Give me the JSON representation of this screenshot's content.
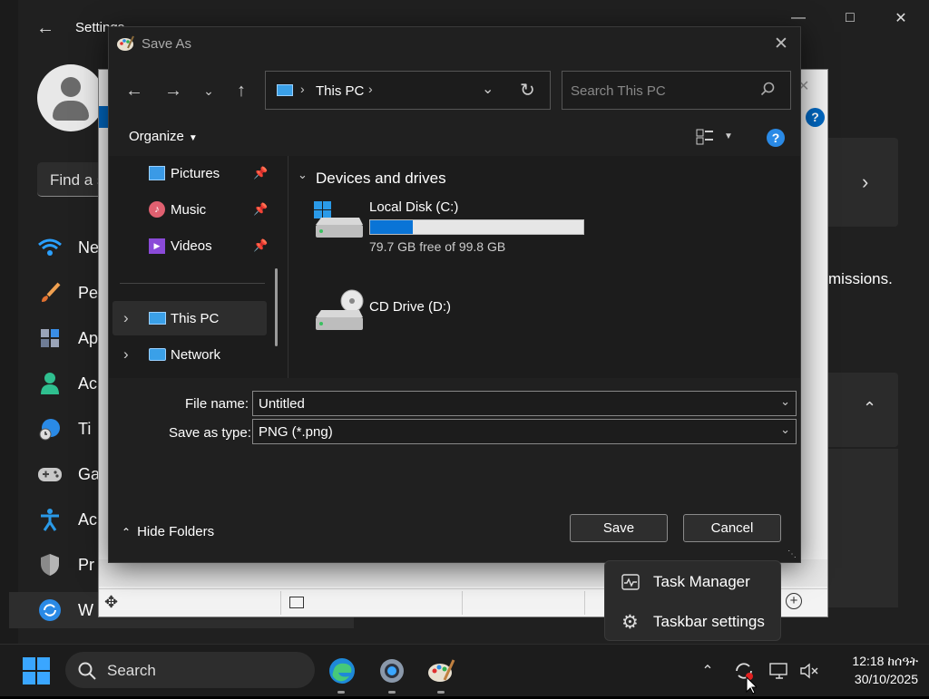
{
  "settings": {
    "title": "Settings",
    "search_placeholder": "Find a s",
    "nav": [
      {
        "label": "Ne",
        "icon": "wifi-icon"
      },
      {
        "label": "Pe",
        "icon": "brush-icon"
      },
      {
        "label": "Ap",
        "icon": "apps-icon"
      },
      {
        "label": "Ac",
        "icon": "person-icon"
      },
      {
        "label": "Ti",
        "icon": "clock-globe-icon"
      },
      {
        "label": "Ga",
        "icon": "gamepad-icon"
      },
      {
        "label": "Ac",
        "icon": "accessibility-icon"
      },
      {
        "label": "Pr",
        "icon": "shield-icon"
      },
      {
        "label": "W",
        "icon": "windows-update-icon"
      }
    ],
    "text_fragment": "missions."
  },
  "dialog": {
    "title": "Save As",
    "breadcrumb": "This PC",
    "search_placeholder": "Search This PC",
    "organize_label": "Organize",
    "quick_access": [
      {
        "label": "Pictures"
      },
      {
        "label": "Music"
      },
      {
        "label": "Videos"
      }
    ],
    "tree": [
      {
        "label": "This PC",
        "selected": true
      },
      {
        "label": "Network",
        "selected": false
      }
    ],
    "section_title": "Devices and drives",
    "drives": [
      {
        "name": "Local Disk (C:)",
        "free_text": "79.7 GB free of 99.8 GB",
        "used_fraction": 0.2
      },
      {
        "name": "CD Drive (D:)"
      }
    ],
    "file_name_label": "File name:",
    "file_name_value": "Untitled",
    "save_type_label": "Save as type:",
    "save_type_value": "PNG (*.png)",
    "hide_folders_label": "Hide Folders",
    "save_label": "Save",
    "cancel_label": "Cancel"
  },
  "context_menu": [
    {
      "label": "Task Manager",
      "icon": "task-manager-icon"
    },
    {
      "label": "Taskbar settings",
      "icon": "gear-icon"
    }
  ],
  "taskbar": {
    "search_label": "Search",
    "time": "12:18 ከሰዓት",
    "date": "30/10/2025"
  },
  "colors": {
    "accent": "#0067c0",
    "dialog_bg": "#202020",
    "taskbar_bg": "#1c1c1c"
  }
}
